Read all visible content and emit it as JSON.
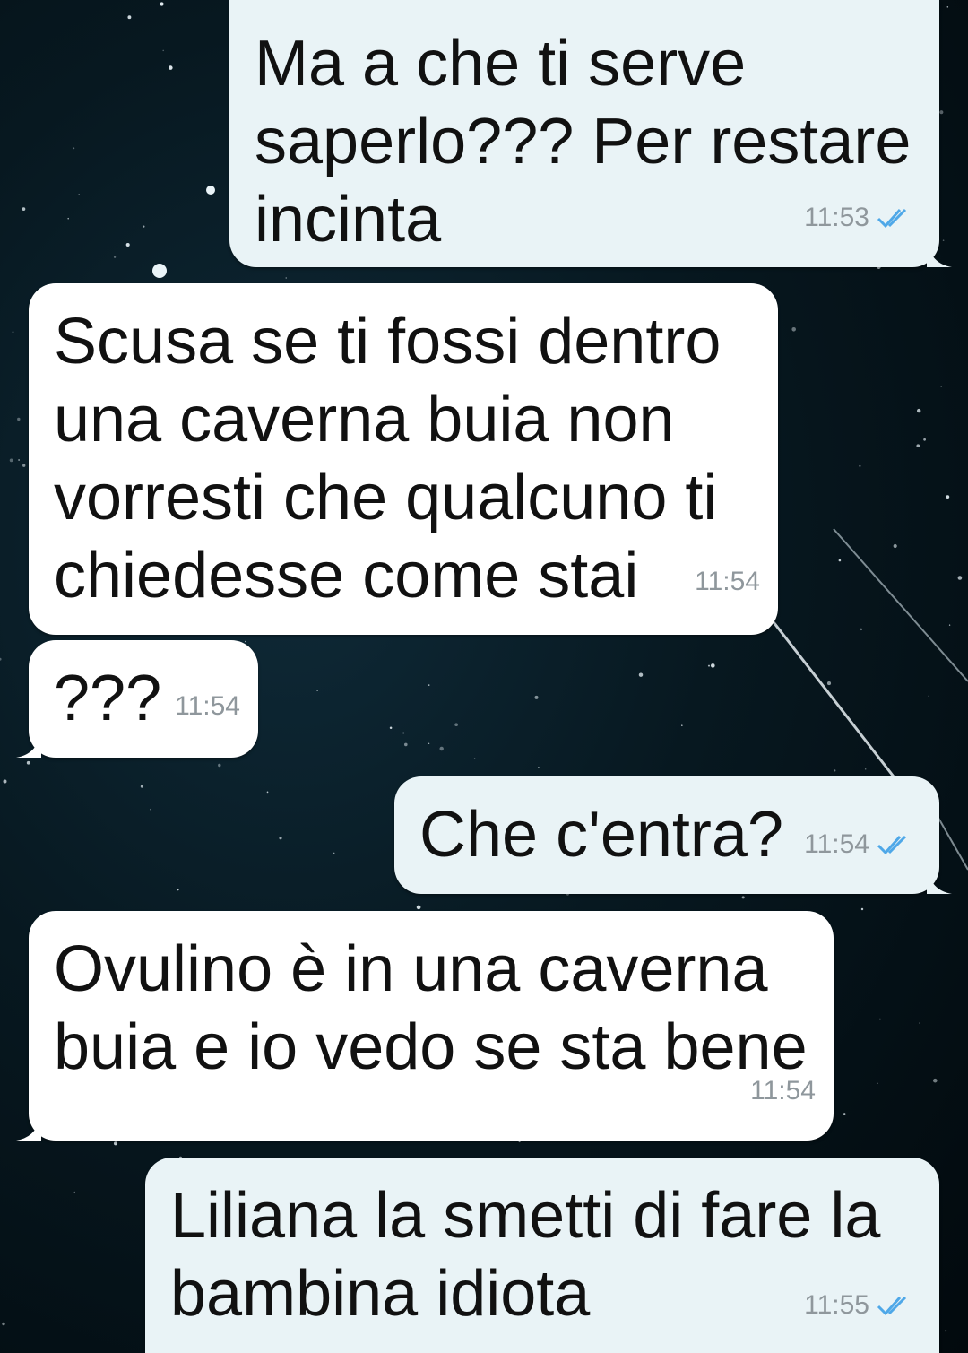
{
  "theme": {
    "outgoing_bubble": "#e9f3f6",
    "incoming_bubble": "#ffffff",
    "tick_color": "#4fa8e8",
    "time_color": "#8f979c"
  },
  "messages": [
    {
      "direction": "outgoing",
      "text": "Ma a che ti serve\nsaperlo??? Per restare\nincinta",
      "time": "11:53",
      "status": "read"
    },
    {
      "direction": "incoming",
      "text": "Scusa se ti fossi dentro\nuna caverna buia non\nvorresti che qualcuno ti\nchiedesse come stai",
      "time": "11:54"
    },
    {
      "direction": "incoming",
      "text": "???",
      "time": "11:54"
    },
    {
      "direction": "outgoing",
      "text": "Che c'entra?",
      "time": "11:54",
      "status": "read"
    },
    {
      "direction": "incoming",
      "text": "Ovulino è in una caverna\nbuia e io vedo se sta bene",
      "time": "11:54"
    },
    {
      "direction": "outgoing",
      "text": "Liliana la smetti di fare la\nbambina idiota",
      "time": "11:55",
      "status": "read"
    }
  ]
}
